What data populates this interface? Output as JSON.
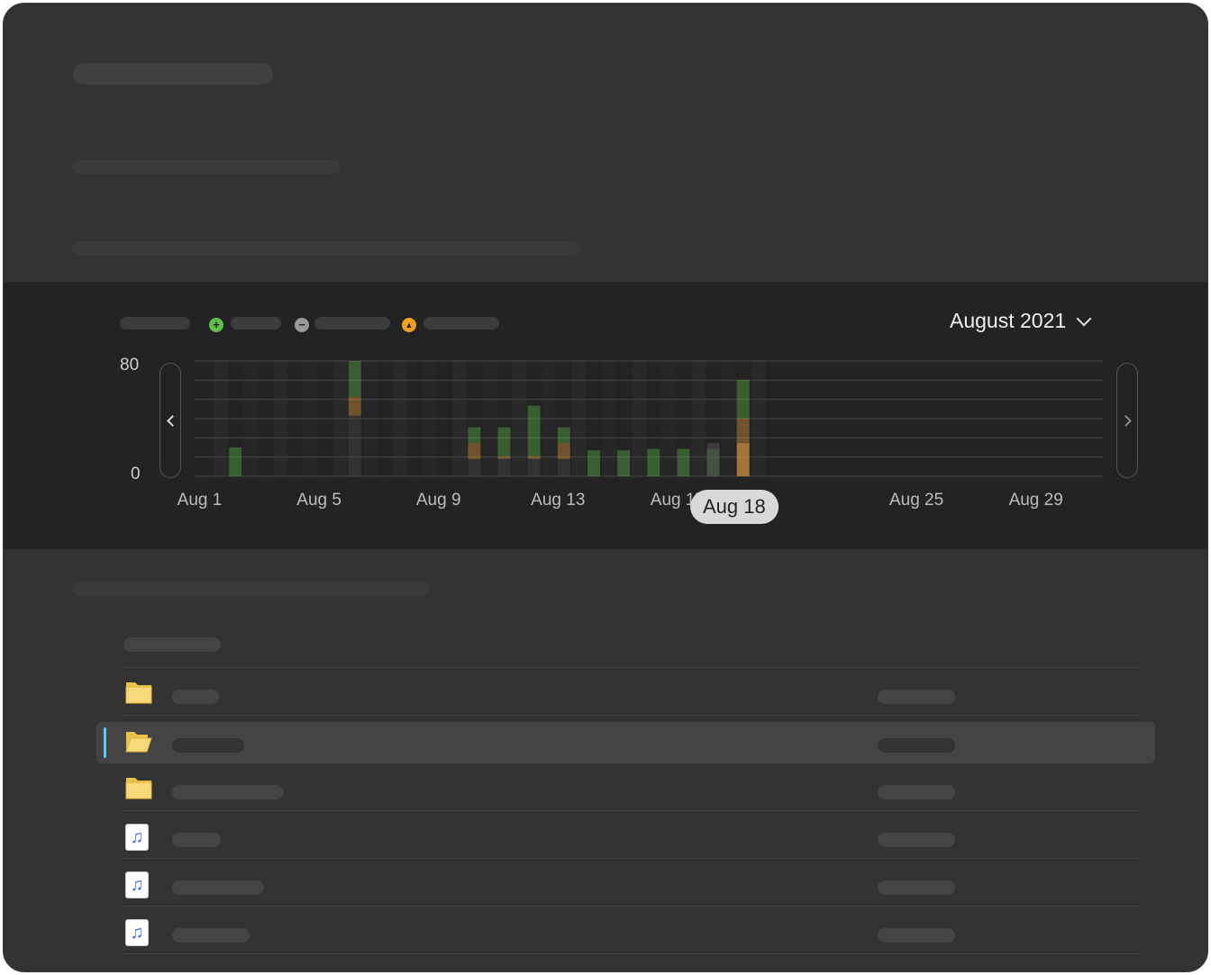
{
  "chart": {
    "month_label": "August 2021",
    "legend": [
      {
        "icon": "plus-circle-icon",
        "glyph": "+",
        "color": "#5ec04b"
      },
      {
        "icon": "minus-circle-icon",
        "glyph": "−",
        "color": "#9a9a9a"
      },
      {
        "icon": "warning-triangle-icon",
        "glyph": "▲",
        "color": "#f0a020"
      }
    ]
  },
  "chart_data": {
    "type": "bar",
    "stacked": true,
    "ylim": [
      0,
      80
    ],
    "yticks": [
      "80",
      "0"
    ],
    "xtick_labels": [
      "Aug 1",
      "Aug 5",
      "Aug 9",
      "Aug 13",
      "Aug 17",
      "Aug 18",
      "Aug 25",
      "Aug 29"
    ],
    "xtick_days": [
      1,
      5,
      9,
      13,
      17,
      18.9,
      25,
      29
    ],
    "selected_label": "Aug 18",
    "days": [
      1,
      2,
      3,
      4,
      5,
      6,
      7,
      8,
      9,
      10,
      11,
      12,
      13,
      14,
      15,
      16,
      17,
      18,
      19,
      20,
      21,
      22,
      23,
      24,
      25,
      26,
      27,
      28,
      29,
      30,
      31
    ],
    "series": [
      {
        "values": [
          0,
          0,
          0,
          0,
          42,
          0,
          0,
          0,
          12,
          12,
          12,
          12,
          0,
          0,
          0,
          0,
          0,
          23,
          0,
          0,
          0,
          0,
          0,
          0,
          0,
          0,
          0,
          0,
          0,
          0,
          0
        ],
        "color": "#4d4d4d"
      },
      {
        "values": [
          0,
          0,
          0,
          0,
          13,
          0,
          0,
          0,
          11,
          2,
          2,
          11,
          0,
          0,
          0,
          0,
          0,
          17,
          0,
          0,
          0,
          0,
          0,
          0,
          0,
          0,
          0,
          0,
          0,
          0,
          0
        ],
        "color": "#f0a040"
      },
      {
        "values": [
          20,
          0,
          0,
          0,
          25,
          0,
          0,
          0,
          11,
          20,
          35,
          11,
          18,
          18,
          19,
          19,
          19,
          27,
          0,
          0,
          0,
          0,
          0,
          0,
          0,
          0,
          0,
          0,
          0,
          0,
          0
        ],
        "color": "#5ec04b"
      }
    ],
    "standalone": [
      {
        "day": 18,
        "value": 23,
        "color": "#4d4d4d"
      },
      {
        "day": 19,
        "value": 23,
        "color": "#f0a040"
      }
    ],
    "highlight_day": 19
  },
  "files": [
    {
      "icon": "folder-icon",
      "selected": false
    },
    {
      "icon": "folder-open-icon",
      "selected": true
    },
    {
      "icon": "folder-icon",
      "selected": false
    },
    {
      "icon": "music-file-icon",
      "selected": false
    },
    {
      "icon": "music-file-icon",
      "selected": false
    },
    {
      "icon": "music-file-icon",
      "selected": false
    }
  ]
}
